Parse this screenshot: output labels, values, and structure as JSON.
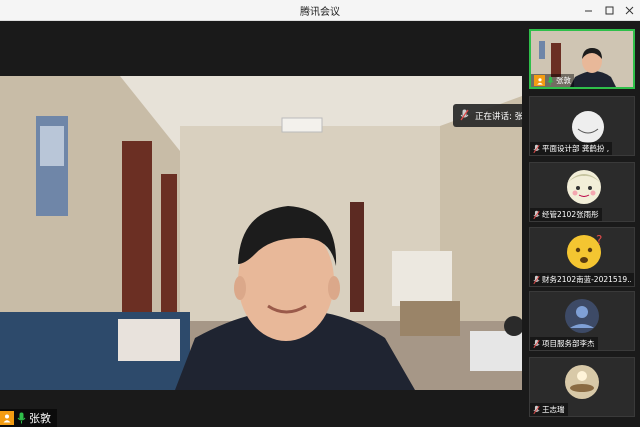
{
  "window": {
    "title": "腾讯会议",
    "controls": [
      "minimize-icon",
      "maximize-icon",
      "close-icon"
    ]
  },
  "main": {
    "speaker_name": "张敦"
  },
  "toast": {
    "text": "正在讲话: 张敦"
  },
  "participants": [
    {
      "name": "张敦",
      "mic": "on",
      "active": true,
      "thumb": "video"
    },
    {
      "name": "平面设计部 龚鹤扮 ,",
      "mic": "muted",
      "active": false,
      "thumb": "avatar-partial"
    },
    {
      "name": "经管2102张雨彤",
      "mic": "muted",
      "active": false,
      "thumb": "cartoon-avatar"
    },
    {
      "name": "财务2102南蓝-2021519...",
      "mic": "muted",
      "active": false,
      "thumb": "emoji-avatar"
    },
    {
      "name": "项目服务部李杰",
      "mic": "muted",
      "active": false,
      "thumb": "photo-avatar"
    },
    {
      "name": "王志瑞",
      "mic": "muted",
      "active": false,
      "thumb": "photo-avatar-light"
    }
  ],
  "colors": {
    "active_border": "#2fbf4a",
    "mic_on": "#2fbf4a",
    "mic_muted": "#e04a4a",
    "avatar_orange": "#f39c12"
  }
}
